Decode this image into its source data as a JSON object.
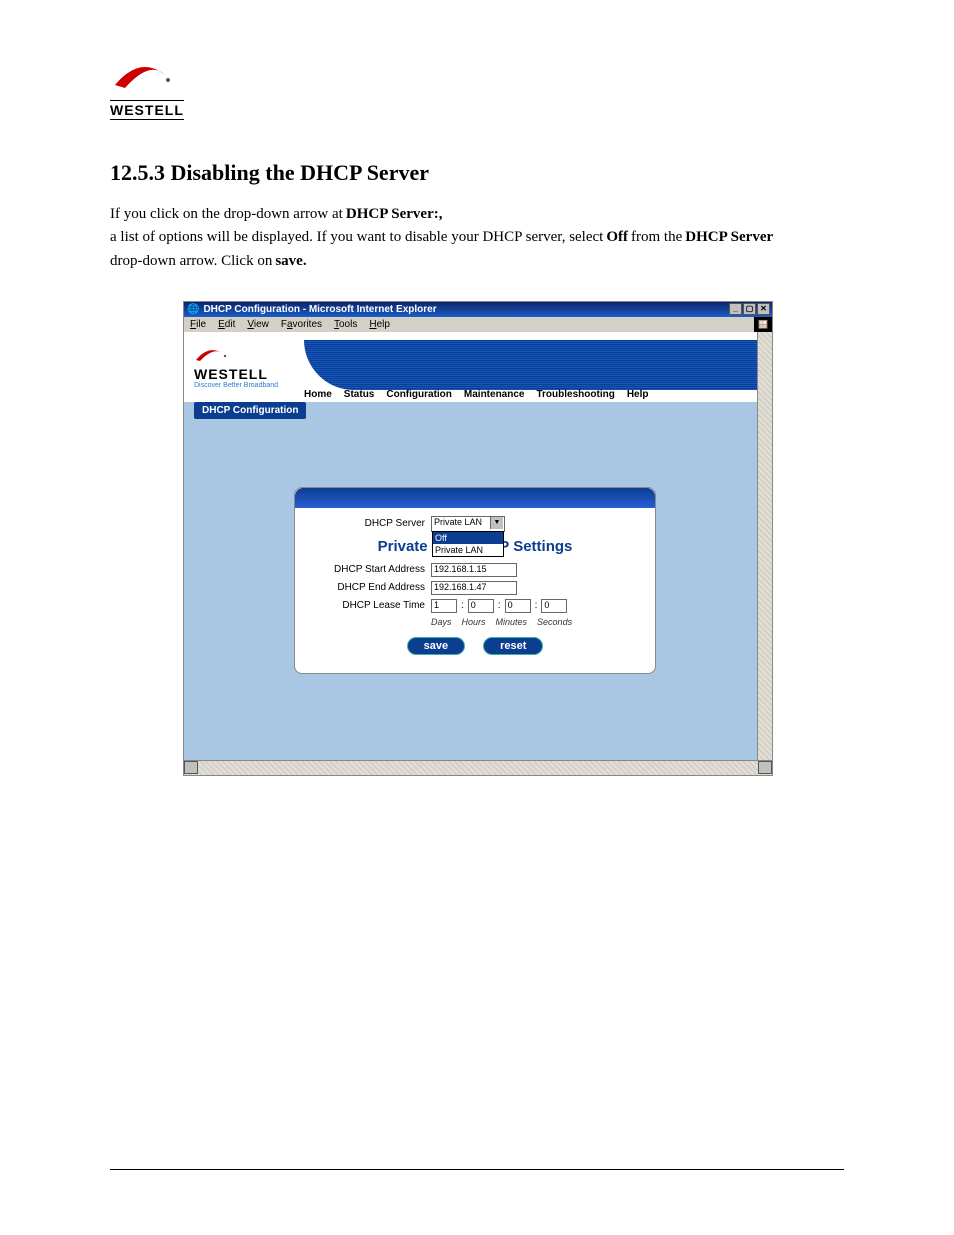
{
  "doc": {
    "section_number": "12.5.3",
    "section_title_rest": "Disabling the DHCP Server",
    "para_prefix": "If you click on the drop-down arrow at",
    "dhcp_server_label": "DHCP Server:,",
    "para_mid1": "a list of options will be displayed. If you want to disable your DHCP server, select",
    "off_label": "Off",
    "para_mid2": "from the",
    "dhcp_server_label2": "DHCP Server",
    "para_mid3": "drop-down arrow. Click on",
    "save_label": "save.",
    "after_save": ""
  },
  "logo": {
    "brand": "WESTELL"
  },
  "ie": {
    "title": "DHCP Configuration - Microsoft Internet Explorer",
    "menu": {
      "file": "File",
      "edit": "Edit",
      "view": "View",
      "favorites": "Favorites",
      "tools": "Tools",
      "help": "Help"
    },
    "ctl": {
      "min": "_",
      "max": "▢",
      "close": "✕"
    },
    "ie_flag": "🪟"
  },
  "app": {
    "brand": "WESTELL",
    "tagline": "Discover Better Broadband",
    "nav": {
      "home": "Home",
      "status": "Status",
      "configuration": "Configuration",
      "maintenance": "Maintenance",
      "troubleshooting": "Troubleshooting",
      "help": "Help"
    },
    "subnav": "DHCP Configuration"
  },
  "panel": {
    "label_server": "DHCP Server",
    "select_value": "Private LAN",
    "dropdown": {
      "opt_off": "Off",
      "opt_private": "Private LAN"
    },
    "title": "Private LAN DHCP Settings",
    "label_start": "DHCP Start Address",
    "val_start": "192.168.1.15",
    "label_end": "DHCP End Address",
    "val_end": "192.168.1.47",
    "label_lease": "DHCP Lease Time",
    "lease_days": "1",
    "lease_hours": "0",
    "lease_minutes": "0",
    "lease_seconds": "0",
    "unit_days": "Days",
    "unit_hours": "Hours",
    "unit_minutes": "Minutes",
    "unit_seconds": "Seconds",
    "btn_save": "save",
    "btn_reset": "reset",
    "colon": ":"
  }
}
